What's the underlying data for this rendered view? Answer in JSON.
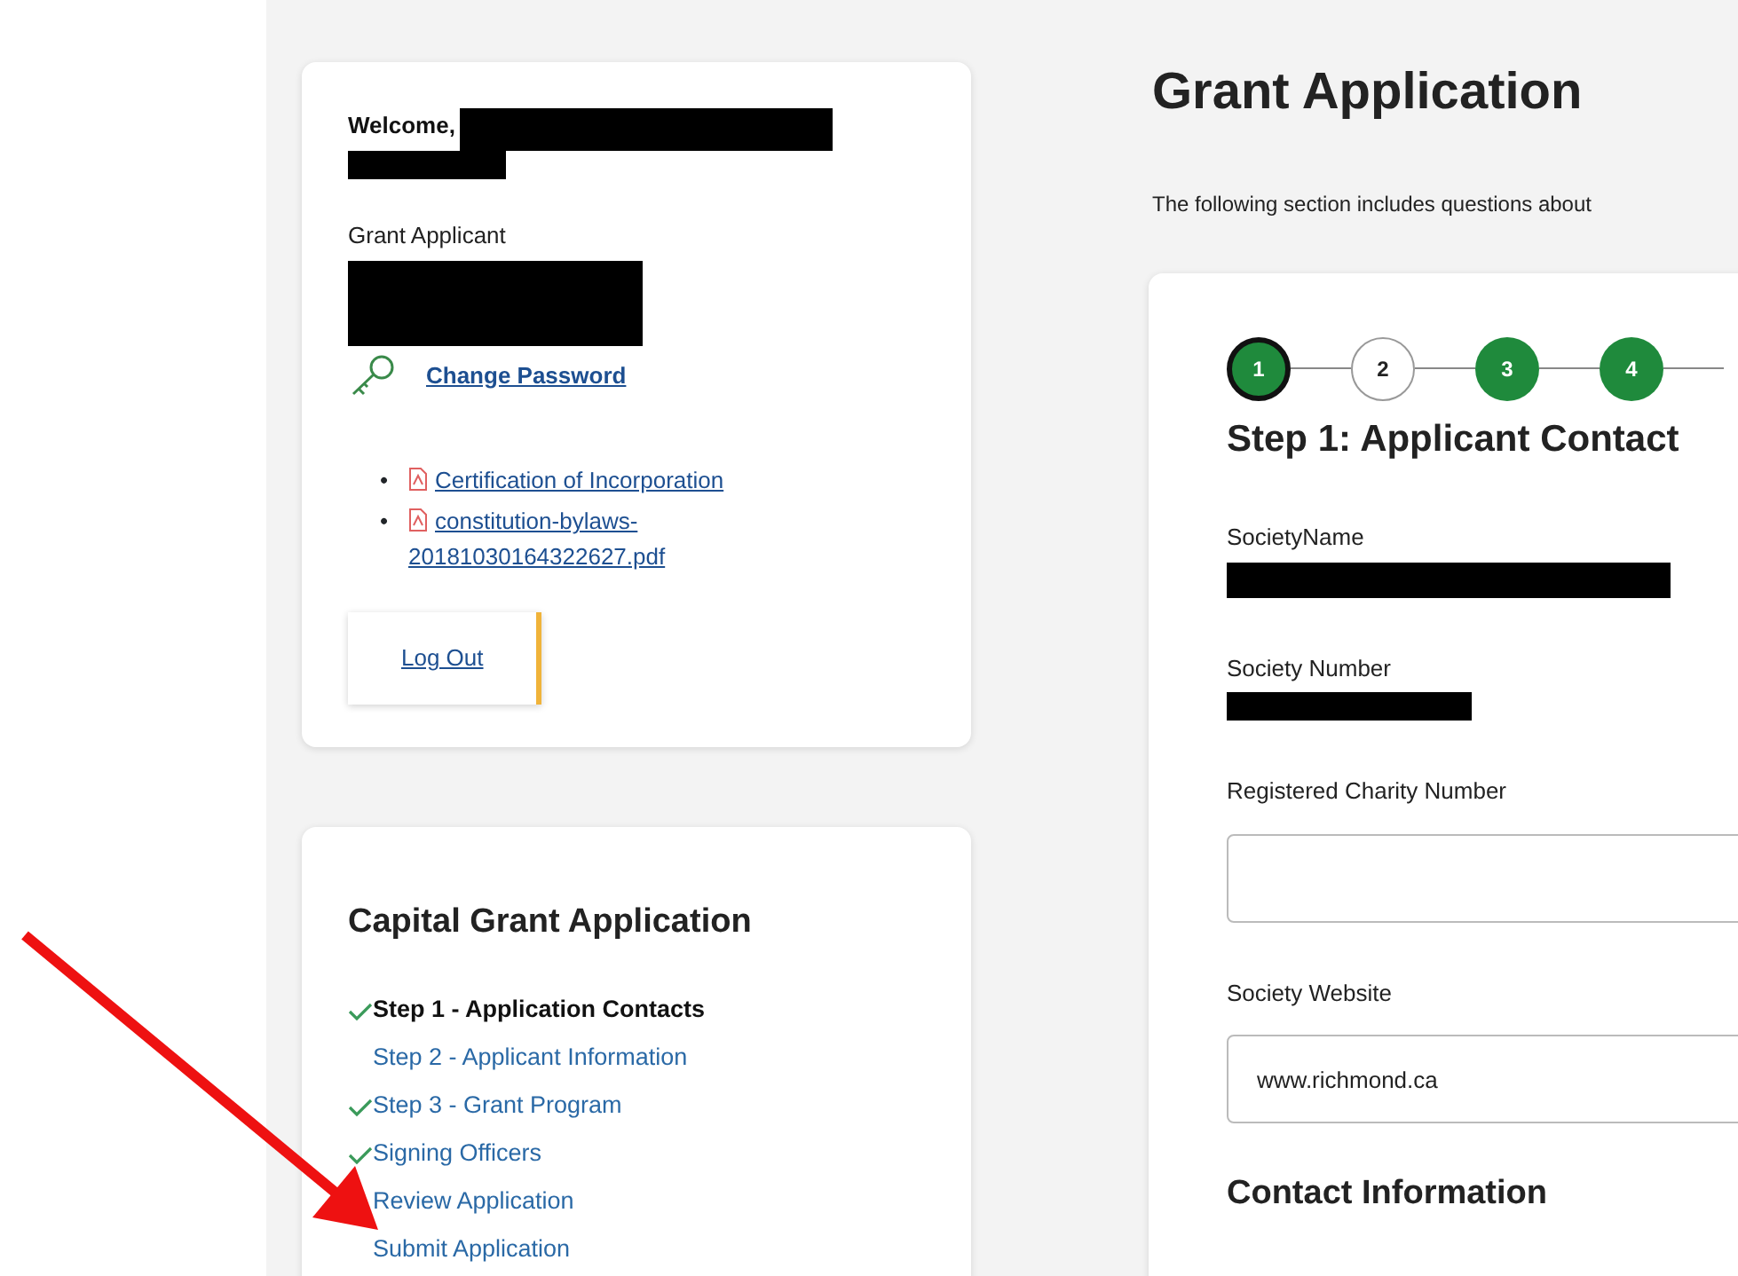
{
  "user_card": {
    "welcome": "Welcome,",
    "role": "Grant Applicant",
    "change_password": "Change Password",
    "documents": [
      {
        "bullet": "•",
        "label": "Certification of Incorporation"
      },
      {
        "bullet": "•",
        "label": "constitution-bylaws-20181030164322627.pdf"
      }
    ],
    "logout": "Log Out"
  },
  "progress_nav": {
    "title": "Capital Grant Application",
    "items": [
      {
        "label": "Step 1 - Application Contacts",
        "checked": true,
        "selected": true
      },
      {
        "label": "Step 2 - Applicant Information",
        "checked": false,
        "selected": false
      },
      {
        "label": "Step 3 - Grant Program",
        "checked": true,
        "selected": false
      },
      {
        "label": "Signing Officers",
        "checked": true,
        "selected": false
      },
      {
        "label": "Review Application",
        "checked": false,
        "selected": false
      },
      {
        "label": "Submit Application",
        "checked": false,
        "selected": false
      }
    ]
  },
  "main": {
    "title": "Grant Application",
    "intro": "The following section includes questions about",
    "stepper": [
      {
        "label": "1",
        "selected": true,
        "complete": true
      },
      {
        "label": "2",
        "selected": false,
        "complete": false
      },
      {
        "label": "3",
        "selected": false,
        "complete": true
      },
      {
        "label": "4",
        "selected": false,
        "complete": true
      }
    ],
    "step_title": "Step 1: Applicant Contact",
    "fields": [
      {
        "label": "SocietyName",
        "kind": "redacted",
        "wide": true
      },
      {
        "label": "Society Number",
        "kind": "redacted",
        "wide": false
      },
      {
        "label": "Registered Charity Number",
        "kind": "input"
      },
      {
        "label": "Society Website",
        "kind": "input",
        "value": "www.richmond.ca"
      }
    ],
    "section_title": "Contact Information"
  }
}
